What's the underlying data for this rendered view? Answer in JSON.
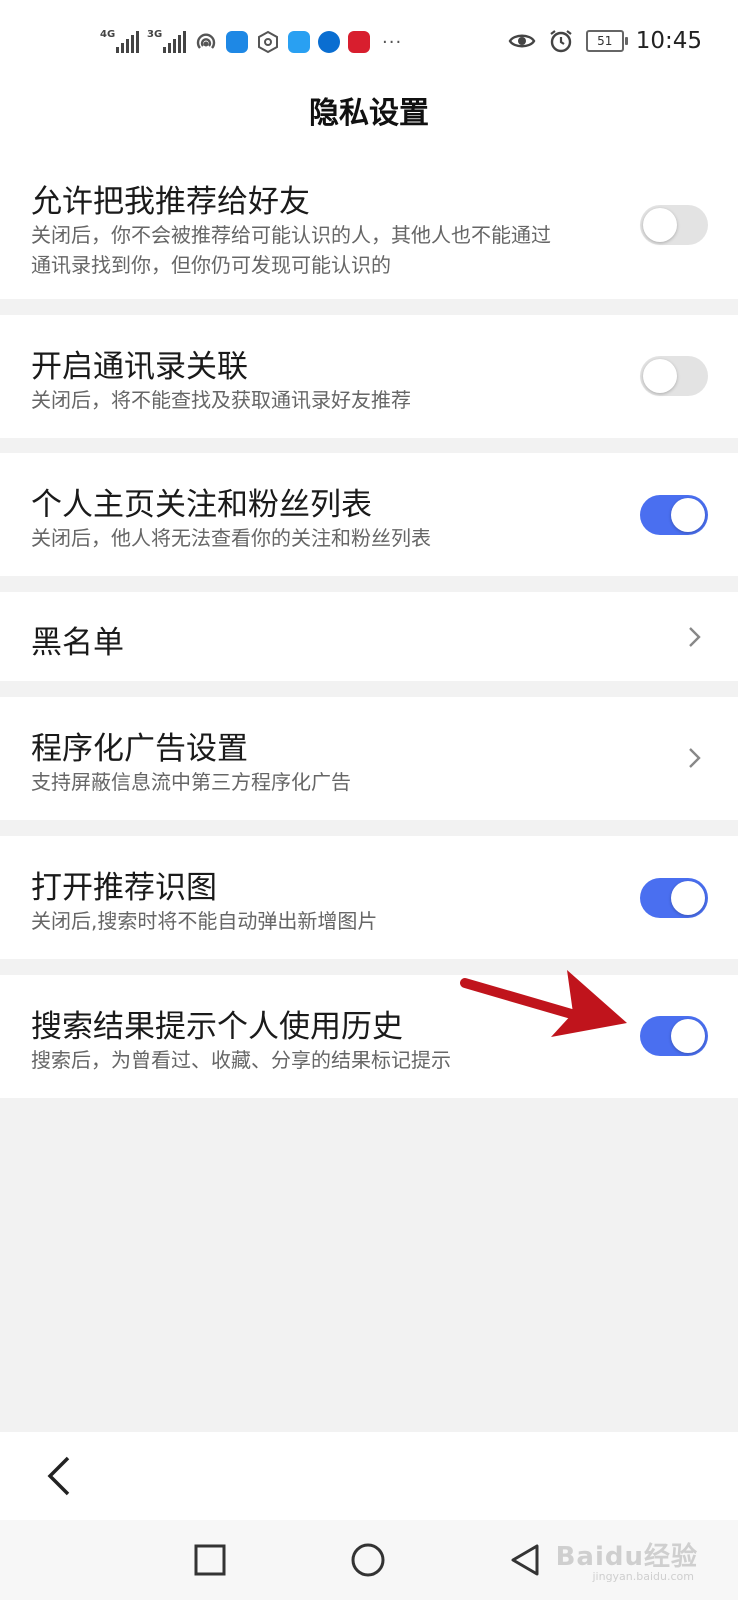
{
  "status_bar": {
    "net1": "4G",
    "net2": "3G",
    "more": "···",
    "battery": "51",
    "time": "10:45",
    "icons": [
      "signal-icon",
      "hotspot-icon",
      "app-icon",
      "hexagon-icon",
      "app-icon",
      "browser-icon",
      "weibo-icon",
      "eye-icon",
      "alarm-icon"
    ]
  },
  "header": {
    "title": "隐私设置"
  },
  "settings": [
    {
      "title": "允许把我推荐给好友",
      "desc": "关闭后，你不会被推荐给可能认识的人，其他人也不能通过通讯录找到你，但你仍可发现可能认识的",
      "control": "toggle",
      "on": false
    },
    {
      "title": "开启通讯录关联",
      "desc": "关闭后，将不能查找及获取通讯录好友推荐",
      "control": "toggle",
      "on": false
    },
    {
      "title": "个人主页关注和粉丝列表",
      "desc": "关闭后，他人将无法查看你的关注和粉丝列表",
      "control": "toggle",
      "on": true
    },
    {
      "title": "黑名单",
      "desc": "",
      "control": "chevron"
    },
    {
      "title": "程序化广告设置",
      "desc": "支持屏蔽信息流中第三方程序化广告",
      "control": "chevron"
    },
    {
      "title": "打开推荐识图",
      "desc": "关闭后,搜索时将不能自动弹出新增图片",
      "control": "toggle",
      "on": true
    },
    {
      "title": "搜索结果提示个人使用历史",
      "desc": "搜索后，为曾看过、收藏、分享的结果标记提示",
      "control": "toggle",
      "on": true
    }
  ],
  "colors": {
    "accent": "#4a6ff0",
    "toggle_off": "#e3e3e3",
    "annotation_arrow": "#c0141c"
  },
  "watermark": {
    "text": "Baidu经验",
    "sub": "jingyan.baidu.com"
  }
}
